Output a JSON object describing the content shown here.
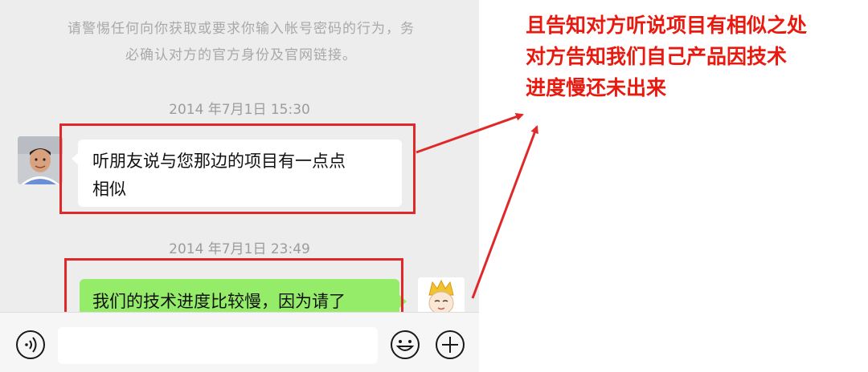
{
  "chat": {
    "security_notice_line1": "请警惕任何向你获取或要求你输入帐号密码的行为，务",
    "security_notice_line2": "必确认对方的官方身份及官网链接。",
    "timestamp_1": "2014 年7月1日 15:30",
    "timestamp_2": "2014 年7月1日 23:49",
    "messages": [
      {
        "side": "left",
        "text_line1": "听朋友说与您那边的项目有一点点",
        "text_line2": "相似"
      },
      {
        "side": "right",
        "text": "我们的技术进度比较慢，因为请了"
      }
    ]
  },
  "input_bar": {
    "voice_icon": "voice-icon",
    "emoji_icon": "emoji-icon",
    "plus_icon": "plus-icon"
  },
  "annotation": {
    "line1": "且告知对方听说项目有相似之处",
    "line2": "对方告知我们自己产品因技术",
    "line3": "进度慢还未出来"
  },
  "colors": {
    "highlight_red": "#e02828",
    "annotation_red": "#e8190f",
    "chat_background": "#ededed",
    "outgoing_bubble": "#95ec69",
    "incoming_bubble": "#ffffff"
  }
}
